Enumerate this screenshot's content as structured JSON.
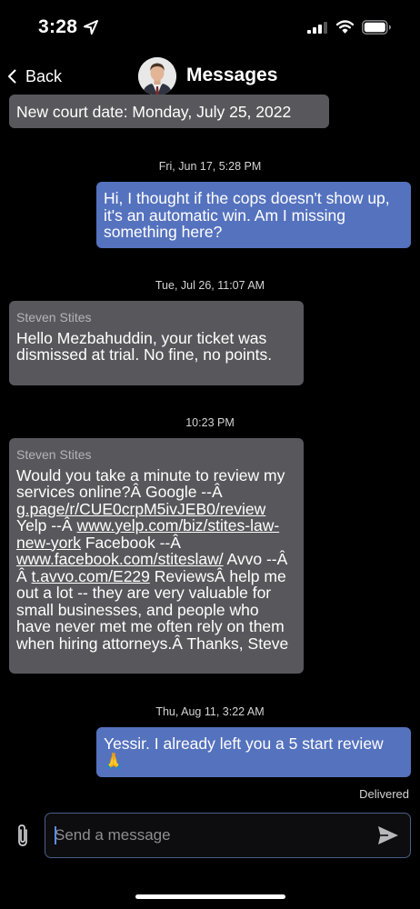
{
  "status_bar": {
    "time": "3:28"
  },
  "nav": {
    "back_label": "Back",
    "title": "Messages"
  },
  "messages": [
    {
      "direction": "in",
      "text": "New court date: Monday, July 25, 2022"
    },
    {
      "timestamp": "Fri, Jun 17, 5:28 PM"
    },
    {
      "direction": "out",
      "text": "Hi, I thought if the cops doesn't show up, it's an automatic win. Am I missing something here?"
    },
    {
      "timestamp": "Tue, Jul 26, 11:07 AM"
    },
    {
      "direction": "in",
      "sender": "Steven Stites",
      "text": "Hello Mezbahuddin, your ticket was dismissed at trial. No fine, no points."
    },
    {
      "timestamp": "10:23 PM"
    },
    {
      "direction": "in",
      "sender": "Steven Stites",
      "parts": [
        "Would you take a minute to review my services online?Â Google --Â ",
        "g.page/r/CUE0crpM5ivJEB0/review",
        " Yelp --Â ",
        "www.yelp.com/biz/stites-law-new-york",
        " Facebook --Â ",
        "www.facebook.com/stiteslaw/",
        " Avvo --Â Â ",
        "t.avvo.com/E229",
        " ReviewsÂ help me out a lot -- they are very valuable for small businesses, and people who have never met me often rely on them when hiring attorneys.Â Thanks, Steve"
      ]
    },
    {
      "timestamp": "Thu, Aug 11, 3:22 AM"
    },
    {
      "direction": "out",
      "text": "Yessir. I already left you a 5 start review 🙏"
    }
  ],
  "delivered_label": "Delivered",
  "composer": {
    "placeholder": "Send a message"
  },
  "colors": {
    "incoming_bubble": "#58585c",
    "outgoing_bubble": "#5572be",
    "background": "#000000"
  }
}
